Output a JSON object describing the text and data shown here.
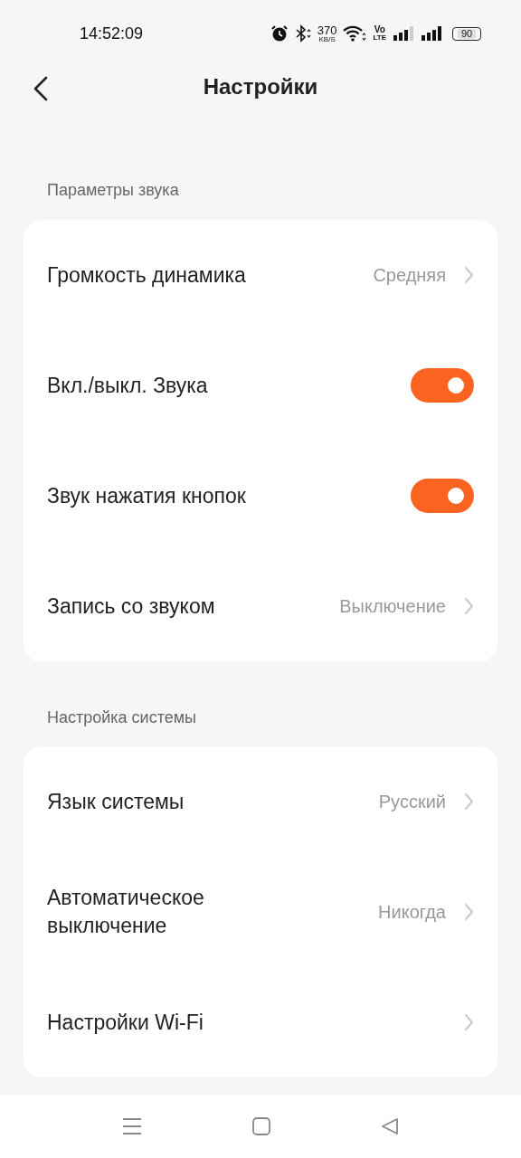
{
  "status_bar": {
    "time": "14:52:09",
    "speed": "370",
    "speed_unit": "KB/S",
    "volte_top": "Vo",
    "volte_bottom": "LTE",
    "battery": "90"
  },
  "header": {
    "title": "Настройки"
  },
  "sections": [
    {
      "title": "Параметры звука",
      "rows": [
        {
          "kind": "value",
          "label": "Громкость динамика",
          "value": "Средняя"
        },
        {
          "kind": "toggle",
          "label": "Вкл./выкл. Звука",
          "on": true
        },
        {
          "kind": "toggle",
          "label": "Звук нажатия кнопок",
          "on": true
        },
        {
          "kind": "value",
          "label": "Запись со звуком",
          "value": "Выключение"
        }
      ]
    },
    {
      "title": "Настройка системы",
      "rows": [
        {
          "kind": "value",
          "label": "Язык системы",
          "value": "Русский"
        },
        {
          "kind": "value",
          "label": "Автоматическое выключение",
          "value": "Никогда"
        },
        {
          "kind": "link",
          "label": "Настройки Wi-Fi"
        }
      ]
    }
  ]
}
